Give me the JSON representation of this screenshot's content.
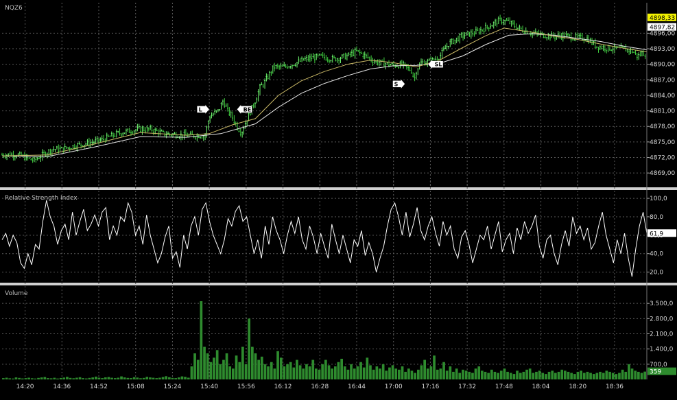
{
  "instrument": "NQZ6",
  "colors": {
    "background": "#000000",
    "grid": "#5a5a5a",
    "separator": "#d0d0d0",
    "candle_up": "#6df26d",
    "candle_down": "#3fcf3f",
    "ma_fast": "#c9b866",
    "ma_slow": "#e8e8e8",
    "rsi_line": "#ffffff",
    "volume_bar": "#2e8b2e",
    "price_tag_yellow": "#f2f200",
    "marker_fill": "#ffffff"
  },
  "chart_data": [
    {
      "type": "candlestick",
      "panel": "price",
      "title": "NQZ6",
      "ylim": [
        4866.5,
        4899.5
      ],
      "yticks": [
        4869,
        4872,
        4875,
        4878,
        4881,
        4884,
        4887,
        4890,
        4893,
        4896
      ],
      "ytick_labels": [
        "4869,00",
        "4872,00",
        "4875,00",
        "4878,00",
        "4881,00",
        "4884,00",
        "4887,00",
        "4890,00",
        "4893,00",
        "4896,00"
      ],
      "last_price_tags": [
        {
          "label": "4898,33",
          "value": 4898.33,
          "color": "#f2f200"
        },
        {
          "label": "4897,82",
          "value": 4897.82,
          "color": "#ffffff"
        }
      ],
      "x_range_minutes": [
        850,
        1130
      ],
      "xticks": [
        "14:20",
        "14:36",
        "14:52",
        "15:08",
        "15:24",
        "15:40",
        "15:56",
        "16:12",
        "16:28",
        "16:44",
        "17:00",
        "17:16",
        "17:32",
        "17:48",
        "18:04",
        "18:20",
        "18:36"
      ],
      "price_path": [
        [
          850,
          4872.5
        ],
        [
          856,
          4872.6
        ],
        [
          860,
          4872.0
        ],
        [
          864,
          4871.4
        ],
        [
          868,
          4872.6
        ],
        [
          872,
          4873.6
        ],
        [
          876,
          4873.6
        ],
        [
          882,
          4874.3
        ],
        [
          888,
          4874.8
        ],
        [
          894,
          4875.5
        ],
        [
          900,
          4876.6
        ],
        [
          904,
          4877.0
        ],
        [
          910,
          4877.5
        ],
        [
          915,
          4877.4
        ],
        [
          920,
          4876.6
        ],
        [
          926,
          4876.4
        ],
        [
          932,
          4876.2
        ],
        [
          936,
          4876.3
        ],
        [
          938,
          4876.0
        ],
        [
          940,
          4879.8
        ],
        [
          942,
          4880.5
        ],
        [
          944,
          4881.0
        ],
        [
          946,
          4883.0
        ],
        [
          948,
          4881.0
        ],
        [
          950,
          4879.8
        ],
        [
          952,
          4878.0
        ],
        [
          954,
          4876.8
        ],
        [
          956,
          4879.0
        ],
        [
          958,
          4881.0
        ],
        [
          960,
          4883.0
        ],
        [
          962,
          4885.5
        ],
        [
          964,
          4886.5
        ],
        [
          966,
          4888.0
        ],
        [
          968,
          4889.5
        ],
        [
          972,
          4889.4
        ],
        [
          976,
          4890.0
        ],
        [
          982,
          4891.0
        ],
        [
          988,
          4891.5
        ],
        [
          994,
          4891.0
        ],
        [
          1000,
          4891.6
        ],
        [
          1004,
          4892.5
        ],
        [
          1008,
          4891.6
        ],
        [
          1012,
          4890.5
        ],
        [
          1016,
          4890.2
        ],
        [
          1020,
          4889.8
        ],
        [
          1024,
          4889.9
        ],
        [
          1028,
          4888.7
        ],
        [
          1029,
          4887.0
        ],
        [
          1030,
          4889.0
        ],
        [
          1032,
          4890.3
        ],
        [
          1036,
          4890.5
        ],
        [
          1040,
          4891.5
        ],
        [
          1044,
          4894.0
        ],
        [
          1050,
          4895.5
        ],
        [
          1056,
          4896.2
        ],
        [
          1062,
          4897.5
        ],
        [
          1066,
          4898.5
        ],
        [
          1070,
          4898.2
        ],
        [
          1074,
          4897.0
        ],
        [
          1080,
          4896.0
        ],
        [
          1086,
          4895.6
        ],
        [
          1090,
          4895.4
        ],
        [
          1094,
          4895.6
        ],
        [
          1098,
          4895.2
        ],
        [
          1104,
          4895.0
        ],
        [
          1108,
          4893.5
        ],
        [
          1112,
          4893.2
        ],
        [
          1116,
          4893.0
        ],
        [
          1120,
          4893.0
        ],
        [
          1124,
          4892.5
        ],
        [
          1126,
          4891.5
        ],
        [
          1128,
          4892.2
        ],
        [
          1130,
          4892.0
        ]
      ],
      "ma_fast": [
        [
          850,
          4872.3
        ],
        [
          870,
          4872.5
        ],
        [
          890,
          4874.6
        ],
        [
          910,
          4876.8
        ],
        [
          930,
          4876.3
        ],
        [
          940,
          4876.6
        ],
        [
          950,
          4878.3
        ],
        [
          960,
          4879.5
        ],
        [
          970,
          4884.0
        ],
        [
          980,
          4886.8
        ],
        [
          990,
          4888.6
        ],
        [
          1000,
          4890.0
        ],
        [
          1010,
          4890.8
        ],
        [
          1020,
          4890.3
        ],
        [
          1030,
          4889.5
        ],
        [
          1040,
          4890.8
        ],
        [
          1050,
          4893.2
        ],
        [
          1060,
          4895.5
        ],
        [
          1068,
          4897.0
        ],
        [
          1080,
          4896.2
        ],
        [
          1090,
          4895.4
        ],
        [
          1100,
          4894.8
        ],
        [
          1110,
          4893.9
        ],
        [
          1120,
          4893.1
        ],
        [
          1130,
          4892.4
        ]
      ],
      "ma_slow": [
        [
          850,
          4872.3
        ],
        [
          870,
          4872.2
        ],
        [
          890,
          4874.0
        ],
        [
          910,
          4876.0
        ],
        [
          930,
          4875.9
        ],
        [
          945,
          4876.6
        ],
        [
          960,
          4878.5
        ],
        [
          970,
          4881.7
        ],
        [
          980,
          4884.4
        ],
        [
          990,
          4886.3
        ],
        [
          1000,
          4887.8
        ],
        [
          1010,
          4889.1
        ],
        [
          1020,
          4889.7
        ],
        [
          1030,
          4889.8
        ],
        [
          1040,
          4890.2
        ],
        [
          1050,
          4891.6
        ],
        [
          1060,
          4893.8
        ],
        [
          1070,
          4895.6
        ],
        [
          1080,
          4895.9
        ],
        [
          1090,
          4895.6
        ],
        [
          1100,
          4895.0
        ],
        [
          1110,
          4894.4
        ],
        [
          1120,
          4893.5
        ],
        [
          1130,
          4892.8
        ]
      ],
      "trade_markers": [
        {
          "label": "L",
          "minute": 940,
          "value": 4881.3,
          "direction": "right"
        },
        {
          "label": "BE",
          "minute": 952,
          "value": 4881.3,
          "direction": "left"
        },
        {
          "label": "S",
          "minute": 1025,
          "value": 4886.2,
          "direction": "right"
        },
        {
          "label": "SL",
          "minute": 1035,
          "value": 4890.0,
          "direction": "left"
        }
      ]
    },
    {
      "type": "line",
      "panel": "rsi",
      "title": "Relative Strength Index",
      "ylim": [
        10,
        106
      ],
      "yticks": [
        20,
        40,
        60,
        80,
        100
      ],
      "ytick_labels": [
        "20,0",
        "40,0",
        "60,0",
        "80,0",
        "100,0"
      ],
      "last_value_label": "61,9",
      "last_value": 61.9,
      "series": [
        {
          "values": [
            55,
            62,
            48,
            60,
            52,
            30,
            24,
            40,
            28,
            50,
            45,
            75,
            98,
            80,
            70,
            50,
            65,
            72,
            55,
            85,
            60,
            75,
            88,
            65,
            72,
            82,
            70,
            85,
            90,
            55,
            70,
            60,
            80,
            75,
            95,
            85,
            60,
            70,
            50,
            82,
            60,
            45,
            30,
            40,
            58,
            70,
            35,
            42,
            25,
            60,
            45,
            70,
            80,
            60,
            88,
            95,
            75,
            60,
            50,
            40,
            55,
            78,
            70,
            86,
            92,
            75,
            80,
            60,
            40,
            55,
            35,
            70,
            50,
            80,
            65,
            55,
            40,
            60,
            75,
            62,
            80,
            55,
            45,
            70,
            58,
            40,
            62,
            48,
            35,
            72,
            55,
            40,
            60,
            45,
            30,
            55,
            48,
            65,
            38,
            52,
            40,
            20,
            35,
            48,
            70,
            88,
            95,
            80,
            60,
            85,
            58,
            72,
            90,
            65,
            55,
            70,
            80,
            62,
            48,
            75,
            60,
            70,
            45,
            35,
            58,
            65,
            50,
            30,
            45,
            60,
            55,
            70,
            45,
            60,
            75,
            42,
            55,
            62,
            40,
            68,
            55,
            75,
            62,
            70,
            82,
            48,
            35,
            55,
            60,
            40,
            28,
            50,
            65,
            48,
            80,
            62,
            70,
            55,
            68,
            45,
            52,
            70,
            85,
            60,
            45,
            30,
            55,
            40,
            62,
            35,
            15,
            45,
            70,
            85,
            62
          ]
        }
      ]
    },
    {
      "type": "bar",
      "panel": "volume",
      "title": "Volume",
      "ylim": [
        0,
        4200
      ],
      "yticks": [
        700,
        1400,
        2100,
        2800,
        3500
      ],
      "ytick_labels": [
        "700,0",
        "1.400,0",
        "2.100,0",
        "2.800,0",
        "3.500,0"
      ],
      "last_value_label": "359",
      "last_value": 359,
      "series": [
        {
          "values": [
            60,
            80,
            50,
            40,
            90,
            70,
            45,
            60,
            80,
            55,
            40,
            70,
            90,
            110,
            60,
            50,
            75,
            40,
            65,
            85,
            120,
            70,
            55,
            80,
            100,
            60,
            45,
            70,
            90,
            130,
            80,
            60,
            95,
            110,
            75,
            60,
            80,
            140,
            90,
            70,
            60,
            100,
            85,
            55,
            70,
            120,
            90,
            75,
            60,
            80,
            110,
            150,
            100,
            70,
            60,
            90,
            140,
            120,
            80,
            600,
            1200,
            900,
            3600,
            1500,
            1200,
            800,
            1000,
            1350,
            700,
            900,
            1200,
            600,
            500,
            1100,
            800,
            1500,
            700,
            2800,
            1500,
            1200,
            900,
            1050,
            700,
            600,
            800,
            500,
            1300,
            1000,
            600,
            700,
            800,
            550,
            900,
            650,
            500,
            700,
            600,
            900,
            500,
            450,
            700,
            900,
            650,
            500,
            600,
            800,
            950,
            600,
            450,
            700,
            500,
            600,
            800,
            550,
            1000,
            650,
            450,
            600,
            500,
            700,
            400,
            550,
            650,
            500,
            450,
            600,
            350,
            500,
            400,
            300,
            450,
            650,
            900,
            500,
            600,
            1100,
            450,
            500,
            800,
            400,
            600,
            350,
            500,
            300,
            450,
            400,
            350,
            300,
            500,
            600,
            400,
            350,
            300,
            450,
            350,
            300,
            400,
            500,
            350,
            300,
            250,
            400,
            300,
            350,
            450,
            500,
            300,
            350,
            400,
            300,
            250,
            350,
            400,
            300,
            350,
            450,
            400,
            350,
            300,
            250,
            350,
            400,
            300,
            350,
            300,
            250,
            300,
            350,
            300,
            400,
            350,
            300,
            250,
            300,
            450,
            350,
            700,
            500,
            400,
            350,
            300,
            359
          ]
        }
      ]
    }
  ]
}
